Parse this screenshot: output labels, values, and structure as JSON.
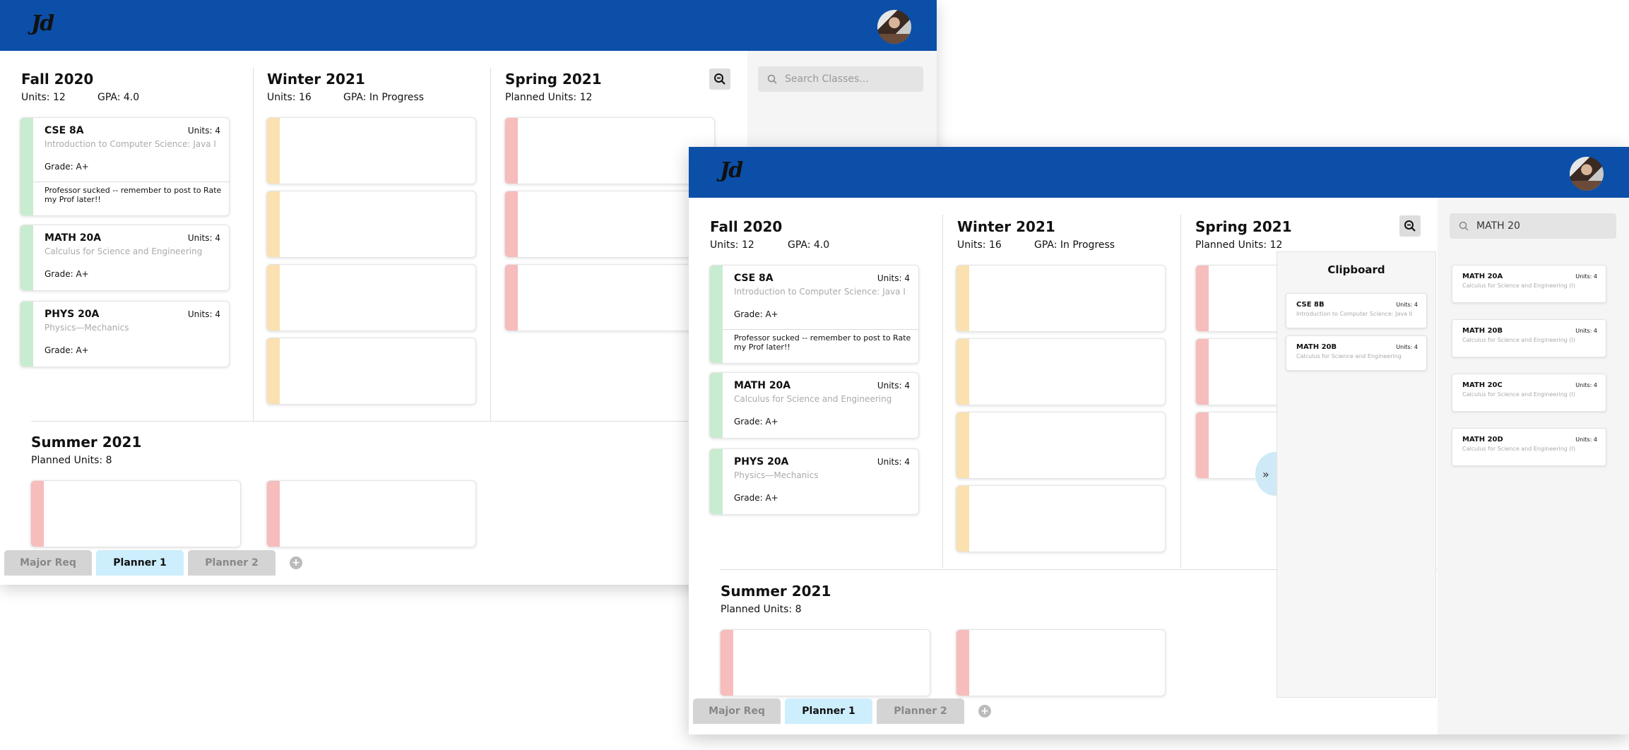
{
  "app": {
    "logo_text": "Jd",
    "tabs": [
      {
        "label": "Major Req"
      },
      {
        "label": "Planner 1"
      },
      {
        "label": "Planner 2"
      }
    ],
    "add_tab_label": "+"
  },
  "semesters": {
    "fall": {
      "title": "Fall 2020",
      "units": "Units: 12",
      "gpa": "GPA: 4.0",
      "courses": [
        {
          "code": "CSE 8A",
          "units": "Units: 4",
          "name": "Introduction to Computer Science: Java I",
          "grade": "Grade: A+",
          "note": "Professor sucked -- remember to post to Rate my Prof later!!"
        },
        {
          "code": "MATH 20A",
          "units": "Units: 4",
          "name": "Calculus for Science and Engineering",
          "grade": "Grade: A+"
        },
        {
          "code": "PHYS 20A",
          "units": "Units: 4",
          "name": "Physics—Mechanics",
          "grade": "Grade: A+"
        }
      ]
    },
    "winter": {
      "title": "Winter 2021",
      "units": "Units: 16",
      "gpa": "GPA: In Progress"
    },
    "spring": {
      "title": "Spring 2021",
      "units": "Planned Units: 12"
    },
    "summer": {
      "title": "Summer  2021",
      "units": "Planned Units: 8"
    }
  },
  "search": {
    "placeholder": "Search Classes...",
    "query": "MATH 20"
  },
  "clipboard": {
    "title": "Clipboard",
    "items": [
      {
        "code": "CSE 8B",
        "units": "Units: 4",
        "name": "Introduction to Computer Science: Java II"
      },
      {
        "code": "MATH 20B",
        "units": "Units: 4",
        "name": "Calculus for Science and Engineering"
      }
    ]
  },
  "search_results": [
    {
      "code": "MATH 20A",
      "units": "Units: 4",
      "name": "Calculus for Science and Engineering (I)"
    },
    {
      "code": "MATH 20B",
      "units": "Units: 4",
      "name": "Calculus for Science and Engineering (I)"
    },
    {
      "code": "MATH 20C",
      "units": "Units: 4",
      "name": "Calculus for Science and Engineering (I)"
    },
    {
      "code": "MATH 20D",
      "units": "Units: 4",
      "name": "Calculus for Science and Engineering (I)"
    }
  ],
  "colors": {
    "header": "#0c4fa8",
    "completed": "#c8ecd0",
    "in_progress": "#fbe0b0",
    "planned": "#f7bcbc",
    "active_tab": "#cdeefc"
  },
  "icons": [
    "search-icon",
    "zoom-out-icon",
    "double-chevron-right-icon",
    "plus-icon",
    "avatar"
  ]
}
